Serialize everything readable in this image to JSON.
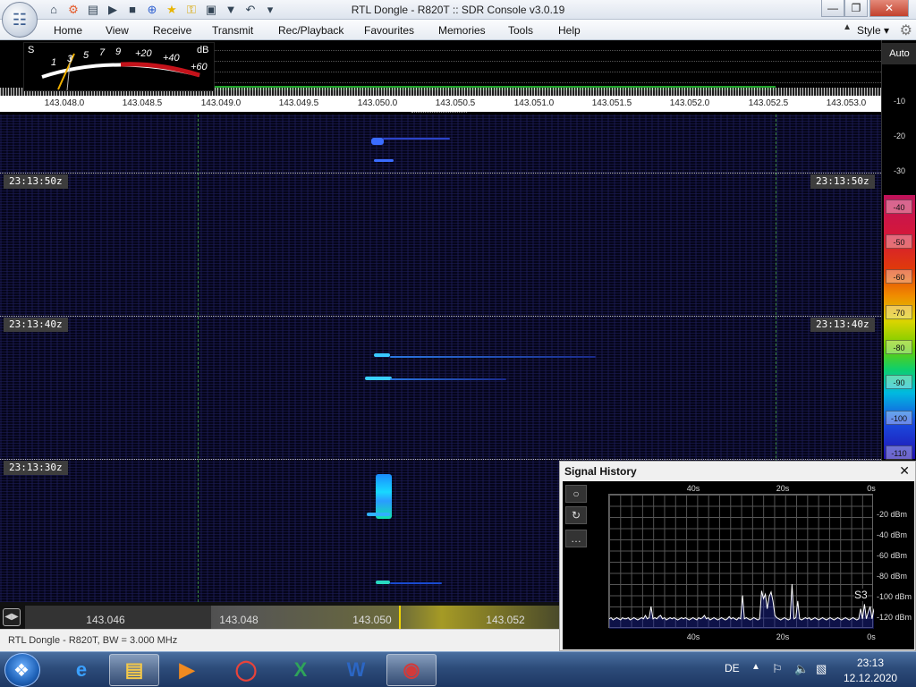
{
  "window": {
    "title": "RTL Dongle - R820T :: SDR Console v3.0.19",
    "minimize": "—",
    "restore": "❐",
    "close": "✕"
  },
  "quick_access": [
    "home-icon",
    "settings-icon",
    "folder-icon",
    "play-icon",
    "stop-icon",
    "add-icon",
    "star-icon",
    "lock-icon",
    "camera-icon",
    "drop-icon",
    "undo-icon",
    "dropdown-icon"
  ],
  "menu": {
    "items": [
      "Home",
      "View",
      "Receive",
      "Transmit",
      "Rec/Playback",
      "Favourites",
      "Memories",
      "Tools",
      "Help"
    ],
    "style_label": "Style"
  },
  "smeter": {
    "s_label": "S",
    "db_label": "dB",
    "scale_s": [
      "1",
      "3",
      "5",
      "7",
      "9"
    ],
    "scale_plus": [
      "+20",
      "+40",
      "+60"
    ]
  },
  "frequency_axis": [
    "143.048.0",
    "143.048.5",
    "143.049.0",
    "143.049.5",
    "143.050.0",
    "143.050.5",
    "143.051.0",
    "143.051.5",
    "143.052.0",
    "143.052.5",
    "143.053.0"
  ],
  "db_scale": {
    "auto_label": "Auto",
    "ticks": [
      "-10",
      "-20",
      "-30"
    ],
    "boxes": [
      "-40",
      "-50",
      "-60",
      "-70",
      "-80",
      "-90",
      "-100",
      "-110"
    ]
  },
  "waterfall": {
    "timestamps": [
      "23:13:50z",
      "23:13:40z",
      "23:13:30z"
    ]
  },
  "overview": {
    "ticks": [
      "143.046",
      "143.048",
      "143.050",
      "143.052"
    ]
  },
  "status": {
    "text": "RTL Dongle - R820T, BW = 3.000 MHz"
  },
  "signal_history": {
    "title": "Signal History",
    "close": "✕",
    "buttons": [
      "○",
      "↻",
      "…"
    ],
    "x_ticks_top": [
      "40s",
      "20s",
      "0s"
    ],
    "x_ticks_bottom": [
      "40s",
      "20s",
      "0s"
    ],
    "y_ticks": [
      "-20 dBm",
      "-40 dBm",
      "-60 dBm",
      "-80 dBm",
      "-100 dBm",
      "-120 dBm"
    ],
    "s_reading": "S3",
    "trace_dbm": [
      -121,
      -120,
      -122,
      -121,
      -120,
      -121,
      -122,
      -120,
      -121,
      -121,
      -120,
      -122,
      -121,
      -120,
      -121,
      -122,
      -121,
      -120,
      -121,
      -118,
      -121,
      -120,
      -110,
      -121,
      -120,
      -121,
      -119,
      -118,
      -121,
      -120,
      -122,
      -121,
      -120,
      -121,
      -120,
      -121,
      -122,
      -121,
      -120,
      -121,
      -120,
      -121,
      -122,
      -121,
      -120,
      -121,
      -122,
      -120,
      -121,
      -120,
      -118,
      -121,
      -120,
      -122,
      -121,
      -120,
      -121,
      -122,
      -121,
      -120,
      -121,
      -122,
      -121,
      -119,
      -121,
      -120,
      -121,
      -122,
      -120,
      -121,
      -100,
      -121,
      -120,
      -121,
      -122,
      -121,
      -120,
      -121,
      -122,
      -121,
      -96,
      -103,
      -99,
      -112,
      -101,
      -97,
      -105,
      -118,
      -120,
      -121,
      -122,
      -121,
      -120,
      -121,
      -122,
      -121,
      -90,
      -121,
      -120,
      -105,
      -121,
      -122,
      -121,
      -120,
      -121,
      -120,
      -122,
      -121,
      -120,
      -121,
      -122,
      -121,
      -120,
      -121,
      -122,
      -121,
      -120,
      -121,
      -122,
      -121,
      -120,
      -121,
      -122,
      -121,
      -120,
      -121,
      -122,
      -121,
      -120,
      -121,
      -122,
      -121,
      -112,
      -121,
      -108,
      -121,
      -115,
      -110,
      -121,
      -112
    ]
  },
  "taskbar": {
    "apps": [
      "ie-icon",
      "explorer-icon",
      "media-player-icon",
      "chrome-icon",
      "excel-icon",
      "word-icon",
      "sdr-console-icon"
    ],
    "language": "DE",
    "time": "23:13",
    "date": "12.12.2020"
  }
}
